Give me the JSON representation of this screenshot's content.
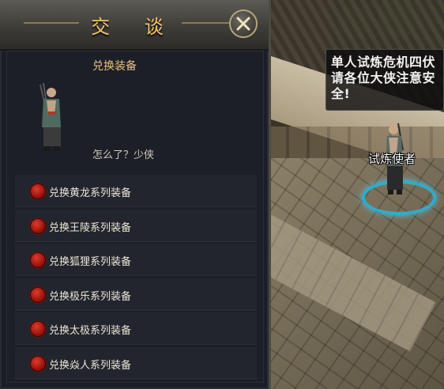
{
  "dialog": {
    "title": "交 谈",
    "npc_title": "兑换装备",
    "greeting": "怎么了？少侠",
    "options": [
      {
        "label": "兑换黄龙系列装备"
      },
      {
        "label": "兑换王陵系列装备"
      },
      {
        "label": "兑换狐狸系列装备"
      },
      {
        "label": "兑换极乐系列装备"
      },
      {
        "label": "兑换太极系列装备"
      },
      {
        "label": "兑换焱人系列装备"
      }
    ]
  },
  "world": {
    "announcement": "单人试炼危机四伏\n请各位大侠注意安\n全!",
    "npc_name": "试炼使者"
  },
  "colors": {
    "title_gold": "#f0c46a",
    "option_dot_red": "#c4221a",
    "selection_ring_cyan": "#2ab3d8"
  },
  "icons": {
    "close": "close-x-icon",
    "option_bullet": "red-orb-icon"
  }
}
